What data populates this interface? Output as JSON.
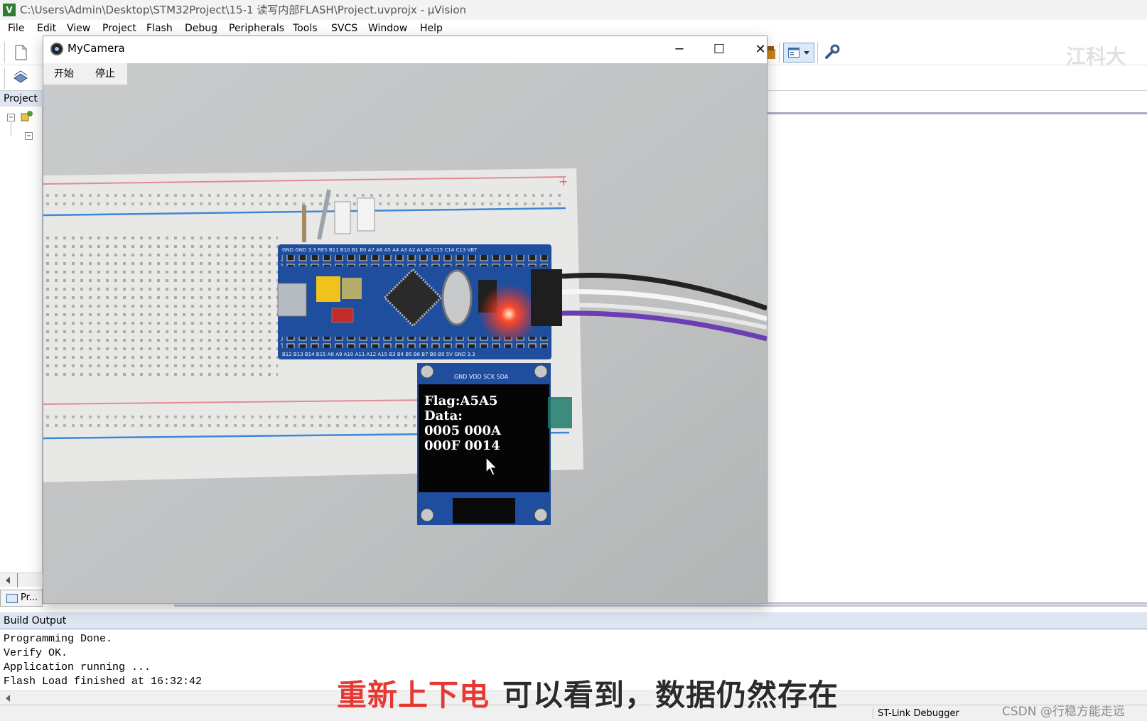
{
  "app": {
    "title": "C:\\Users\\Admin\\Desktop\\STM32Project\\15-1 读写内部FLASH\\Project.uvprojx - µVision",
    "logo_text": "V"
  },
  "menu": [
    "File",
    "Edit",
    "View",
    "Project",
    "Flash",
    "Debug",
    "Peripherals",
    "Tools",
    "SVCS",
    "Window",
    "Help"
  ],
  "project_pane": {
    "title": "Project",
    "tab_label": "Pr..."
  },
  "camera_window": {
    "title": "MyCamera",
    "buttons": {
      "start": "开始",
      "stop": "停止"
    },
    "controls": {
      "minimize": "─",
      "maximize": "☐",
      "close": "✕"
    },
    "oled": {
      "lines": [
        "Flag:A5A5",
        "Data:",
        "0005 000A",
        "000F 0014"
      ]
    },
    "board": {
      "header_top": "GND GND 3.3 RES B11 B10 B1 B0 A7 A6 A5 A4 A3 A2 A1 A0 C15 C14 C13 VBT",
      "header_bottom": "B12 B13 B14 B15 A8 A9 A10 A11 A12 A15 B3 B4 B5 B6 B7 B8 B9 5V GND 3.3",
      "oled_pins": "GND VDD SCK SDA"
    }
  },
  "build_output": {
    "title": "Build Output",
    "lines": [
      "Programming Done.",
      "Verify OK.",
      "Application running ...",
      "Flash Load finished at 16:32:42"
    ],
    "debugger": "ST-Link Debugger"
  },
  "subtitle": {
    "red": "重新上下电",
    "dark": "可以看到，数据仍然存在"
  },
  "watermark": "CSDN @行稳方能走远",
  "corner_mark": "江科大",
  "colors": {
    "pcb_blue": "#1f4e9e",
    "oled_text": "#ffffff",
    "led_red": "#ff2a1a",
    "subtitle_red": "#e53935"
  }
}
